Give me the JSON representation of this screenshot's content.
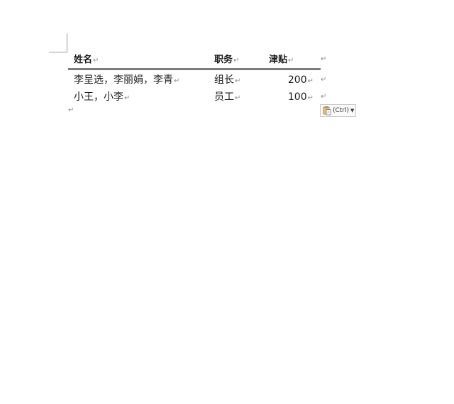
{
  "table": {
    "headers": [
      "姓名",
      "职务",
      "津贴"
    ],
    "rows": [
      {
        "name": "李呈选，李丽娟，李青",
        "role": "组长",
        "allowance": "200"
      },
      {
        "name": "小王，小李",
        "role": "员工",
        "allowance": "100"
      }
    ]
  },
  "marks": {
    "cell_end": "↵",
    "paragraph": "↵"
  },
  "paste_options": {
    "label": "(Ctrl)",
    "icon": "clipboard-paste-icon"
  }
}
